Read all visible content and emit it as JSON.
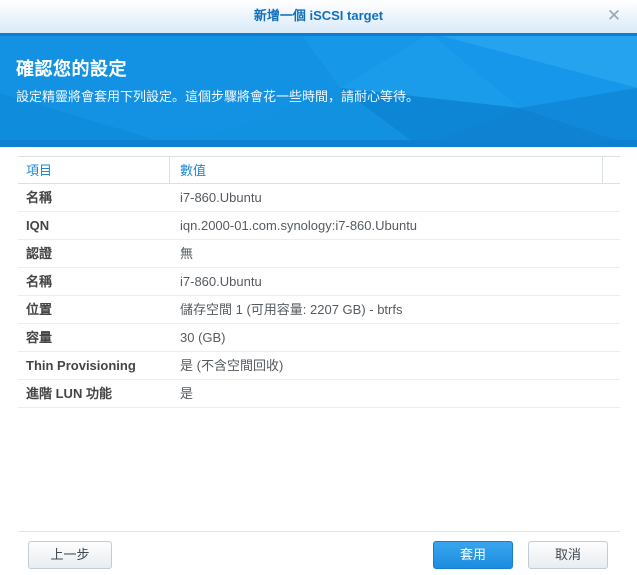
{
  "dialog": {
    "title": "新增一個 iSCSI target",
    "close_icon": "✕"
  },
  "banner": {
    "heading": "確認您的設定",
    "subheading": "設定精靈將會套用下列設定。這個步驟將會花一些時間，請耐心等待。"
  },
  "table": {
    "columns": [
      "項目",
      "數值"
    ],
    "rows": [
      {
        "item": "名稱",
        "value": "i7-860.Ubuntu"
      },
      {
        "item": "IQN",
        "value": "iqn.2000-01.com.synology:i7-860.Ubuntu"
      },
      {
        "item": "認證",
        "value": "無"
      },
      {
        "item": "名稱",
        "value": "i7-860.Ubuntu"
      },
      {
        "item": "位置",
        "value": "儲存空間 1 (可用容量: 2207 GB) - btrfs"
      },
      {
        "item": "容量",
        "value": "30 (GB)"
      },
      {
        "item": "Thin Provisioning",
        "value": "是 (不含空間回收)"
      },
      {
        "item": "進階 LUN 功能",
        "value": "是"
      }
    ]
  },
  "footer": {
    "back_label": "上一步",
    "apply_label": "套用",
    "cancel_label": "取消"
  },
  "colors": {
    "title_text": "#1271be",
    "banner_base": "#1392e4",
    "banner_edge": "#0d7ecf",
    "table_header_text": "#1e88d2",
    "apply_button": "#2196e6"
  }
}
